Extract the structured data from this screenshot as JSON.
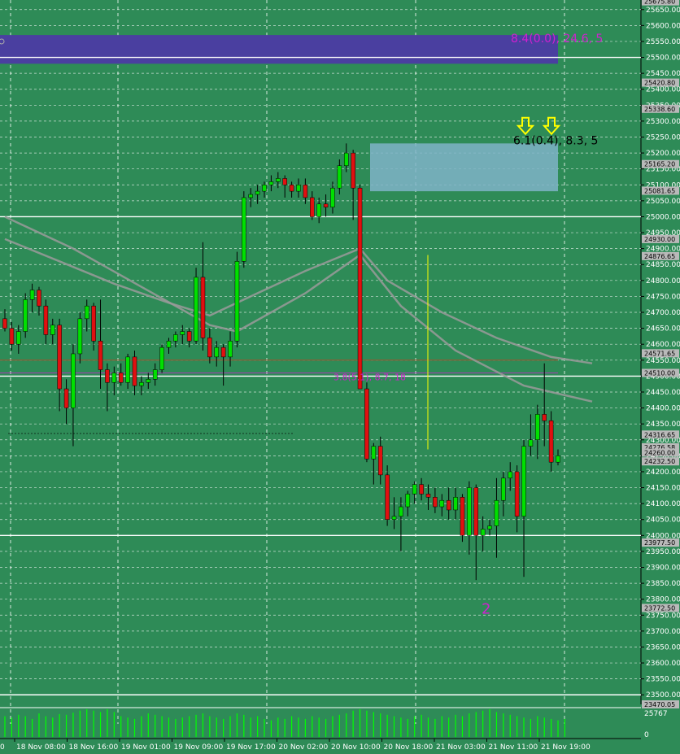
{
  "colors": {
    "background": "#2e8b57",
    "grid": "#ffffff",
    "bull": "#00e000",
    "bear": "#e01010",
    "wick": "#000000",
    "ma": "#9a9a9a",
    "zone_supply": "#4a3fa0",
    "zone_demand": "#7fb3c8",
    "volume": "#00ff00",
    "magenta": "#d020d0",
    "yellow": "#ffff00"
  },
  "chart_data": {
    "type": "candlestick",
    "title": "",
    "ylim": [
      23470,
      25680
    ],
    "price_ticks": [
      25650,
      25600,
      25550,
      25500,
      25450,
      25400,
      25350,
      25300,
      25250,
      25200,
      25150,
      25100,
      25050,
      25000,
      24950,
      24900,
      24850,
      24800,
      24750,
      24700,
      24650,
      24600,
      24550,
      24500,
      24450,
      24400,
      24350,
      24300,
      24250,
      24200,
      24150,
      24100,
      24050,
      24000,
      23950,
      23900,
      23850,
      23800,
      23750,
      23700,
      23650,
      23600,
      23550,
      23500
    ],
    "price_tick_labels": [
      "25650.00",
      "25600.00",
      "25550.00",
      "25500.00",
      "25450.00",
      "25400.00",
      "25350.00",
      "25300.00",
      "25250.00",
      "25200.00",
      "25150.00",
      "25100.00",
      "25050.00",
      "25000.00",
      "24950.00",
      "24900.00",
      "24850.00",
      "24800.00",
      "24750.00",
      "24700.00",
      "24650.00",
      "24600.00",
      "24550.00",
      "24500.00",
      "24450.00",
      "24400.00",
      "24350.00",
      "24300.00",
      "24250.00",
      "24200.00",
      "24150.00",
      "24100.00",
      "24050.00",
      "24000.00",
      "23950.00",
      "23900.00",
      "23850.00",
      "23800.00",
      "23750.00",
      "23700.00",
      "23650.00",
      "23600.00",
      "23550.00",
      "23500.00"
    ],
    "extra_price_labels": [
      {
        "price": 25675.8,
        "text": "25675.80"
      },
      {
        "price": 25420.8,
        "text": "25420.80"
      },
      {
        "price": 25338.6,
        "text": "25338.60"
      },
      {
        "price": 25165.2,
        "text": "25165.20"
      },
      {
        "price": 25081.6,
        "text": "25081.65"
      },
      {
        "price": 24930.0,
        "text": "24930.00"
      },
      {
        "price": 24876.6,
        "text": "24876.65"
      },
      {
        "price": 24571.6,
        "text": "24571.65"
      },
      {
        "price": 24510.0,
        "text": "24510.00"
      },
      {
        "price": 24316.6,
        "text": "24316.65"
      },
      {
        "price": 24276.6,
        "text": "24276.58"
      },
      {
        "price": 24260.0,
        "text": "24260.00"
      },
      {
        "price": 24232.5,
        "text": "24232.50"
      },
      {
        "price": 23977.5,
        "text": "23977.50"
      },
      {
        "price": 23772.5,
        "text": "23772.50"
      },
      {
        "price": 23470.0,
        "text": "23470.05"
      }
    ],
    "highlight_prices": [
      24276.58
    ],
    "time_labels": [
      "18 Nov 08:00",
      "18 Nov 16:00",
      "19 Nov 01:00",
      "19 Nov 09:00",
      "19 Nov 17:00",
      "20 Nov 02:00",
      "20 Nov 10:00",
      "20 Nov 18:00",
      "21 Nov 03:00",
      "21 Nov 11:00",
      "21 Nov 19:00"
    ],
    "first_time_label": "0",
    "volume_labels": [
      "25767",
      "0"
    ],
    "annotations": [
      {
        "text": "8.4(0.0), 24.6, 5",
        "price": 25560,
        "color": "magenta"
      },
      {
        "text": "6.1(0.4), 8.3, 5",
        "price": 25240,
        "color": "black"
      },
      {
        "text": "3.8(5.1), 8.7, 18",
        "price": 24497,
        "color": "magenta"
      },
      {
        "text": "2",
        "price": 23775,
        "color": "magenta"
      }
    ],
    "candles": [
      [
        24680,
        24710,
        24640,
        24650
      ],
      [
        24650,
        24670,
        24580,
        24600
      ],
      [
        24600,
        24660,
        24570,
        24640
      ],
      [
        24640,
        24760,
        24620,
        24740
      ],
      [
        24740,
        24790,
        24700,
        24770
      ],
      [
        24770,
        24780,
        24690,
        24720
      ],
      [
        24720,
        24740,
        24600,
        24630
      ],
      [
        24630,
        24680,
        24600,
        24660
      ],
      [
        24660,
        24680,
        24390,
        24460
      ],
      [
        24460,
        24490,
        24350,
        24400
      ],
      [
        24400,
        24600,
        24280,
        24570
      ],
      [
        24570,
        24700,
        24540,
        24680
      ],
      [
        24680,
        24740,
        24640,
        24720
      ],
      [
        24720,
        24730,
        24580,
        24610
      ],
      [
        24610,
        24740,
        24460,
        24520
      ],
      [
        24520,
        24540,
        24390,
        24480
      ],
      [
        24480,
        24530,
        24440,
        24510
      ],
      [
        24510,
        24540,
        24470,
        24480
      ],
      [
        24480,
        24570,
        24460,
        24560
      ],
      [
        24560,
        24580,
        24440,
        24470
      ],
      [
        24470,
        24500,
        24440,
        24480
      ],
      [
        24480,
        24510,
        24460,
        24490
      ],
      [
        24490,
        24540,
        24470,
        24520
      ],
      [
        24520,
        24600,
        24510,
        24590
      ],
      [
        24590,
        24620,
        24570,
        24610
      ],
      [
        24610,
        24640,
        24590,
        24630
      ],
      [
        24630,
        24660,
        24600,
        24640
      ],
      [
        24640,
        24650,
        24590,
        24610
      ],
      [
        24610,
        24840,
        24600,
        24810
      ],
      [
        24810,
        24920,
        24580,
        24620
      ],
      [
        24620,
        24650,
        24540,
        24560
      ],
      [
        24560,
        24610,
        24530,
        24590
      ],
      [
        24590,
        24600,
        24470,
        24560
      ],
      [
        24560,
        24640,
        24530,
        24610
      ],
      [
        24610,
        24890,
        24590,
        24860
      ],
      [
        24860,
        25080,
        24840,
        25060
      ],
      [
        25060,
        25090,
        25030,
        25070
      ],
      [
        25070,
        25100,
        25040,
        25080
      ],
      [
        25080,
        25110,
        25060,
        25100
      ],
      [
        25100,
        25130,
        25080,
        25110
      ],
      [
        25110,
        25140,
        25090,
        25120
      ],
      [
        25120,
        25130,
        25060,
        25100
      ],
      [
        25100,
        25110,
        25060,
        25080
      ],
      [
        25080,
        25120,
        25060,
        25100
      ],
      [
        25100,
        25120,
        25040,
        25060
      ],
      [
        25060,
        25080,
        24990,
        25000
      ],
      [
        25000,
        25060,
        24980,
        25040
      ],
      [
        25040,
        25070,
        25000,
        25030
      ],
      [
        25030,
        25110,
        25010,
        25090
      ],
      [
        25090,
        25180,
        25070,
        25160
      ],
      [
        25160,
        25230,
        25140,
        25200
      ],
      [
        25200,
        25210,
        24990,
        25090
      ],
      [
        25090,
        25100,
        24460,
        24460
      ],
      [
        24460,
        24480,
        24230,
        24240
      ],
      [
        24240,
        24290,
        24160,
        24280
      ],
      [
        24280,
        24310,
        24160,
        24190
      ],
      [
        24190,
        24220,
        24030,
        24050
      ],
      [
        24050,
        24120,
        24020,
        24060
      ],
      [
        24060,
        24120,
        23950,
        24090
      ],
      [
        24090,
        24140,
        24060,
        24130
      ],
      [
        24130,
        24170,
        24100,
        24160
      ],
      [
        24160,
        24180,
        24110,
        24130
      ],
      [
        24130,
        24160,
        24080,
        24120
      ],
      [
        24120,
        24150,
        24070,
        24090
      ],
      [
        24090,
        24130,
        24060,
        24110
      ],
      [
        24110,
        24150,
        24050,
        24080
      ],
      [
        24080,
        24150,
        24050,
        24120
      ],
      [
        24120,
        24130,
        23980,
        24000
      ],
      [
        24000,
        24170,
        23940,
        24150
      ],
      [
        24150,
        24160,
        23860,
        24000
      ],
      [
        24000,
        24060,
        23950,
        24020
      ],
      [
        24020,
        24050,
        24000,
        24030
      ],
      [
        24030,
        24180,
        23930,
        24110
      ],
      [
        24110,
        24200,
        24060,
        24180
      ],
      [
        24180,
        24230,
        24140,
        24200
      ],
      [
        24200,
        24220,
        24010,
        24060
      ],
      [
        24060,
        24300,
        23870,
        24280
      ],
      [
        24280,
        24380,
        24250,
        24300
      ],
      [
        24300,
        24410,
        24240,
        24380
      ],
      [
        24380,
        24540,
        24280,
        24360
      ],
      [
        24360,
        24390,
        24200,
        24230
      ],
      [
        24230,
        24270,
        24220,
        24250
      ]
    ],
    "moving_averages": [
      {
        "name": "",
        "points": [
          [
            0,
            24930
          ],
          [
            8,
            24860
          ],
          [
            16,
            24790
          ],
          [
            24,
            24730
          ],
          [
            30,
            24690
          ],
          [
            36,
            24750
          ],
          [
            44,
            24830
          ],
          [
            52,
            24900
          ],
          [
            56,
            24800
          ],
          [
            64,
            24700
          ],
          [
            72,
            24620
          ],
          [
            80,
            24560
          ],
          [
            86,
            24540
          ]
        ]
      },
      {
        "name": "",
        "points": [
          [
            0,
            25000
          ],
          [
            10,
            24900
          ],
          [
            20,
            24780
          ],
          [
            30,
            24660
          ],
          [
            34,
            24640
          ],
          [
            44,
            24760
          ],
          [
            52,
            24880
          ],
          [
            58,
            24720
          ],
          [
            66,
            24580
          ],
          [
            76,
            24470
          ],
          [
            82,
            24440
          ],
          [
            86,
            24420
          ]
        ]
      }
    ],
    "volume": [
      30,
      28,
      32,
      30,
      26,
      34,
      30,
      28,
      33,
      32,
      35,
      38,
      40,
      38,
      36,
      40,
      36,
      30,
      28,
      26,
      30,
      34,
      32,
      30,
      28,
      26,
      28,
      30,
      32,
      34,
      30,
      28,
      26,
      30,
      34,
      32,
      28,
      30,
      26,
      24,
      28,
      26,
      30,
      28,
      26,
      30,
      28,
      26,
      30,
      32,
      34,
      38,
      40,
      38,
      36,
      34,
      32,
      30,
      28,
      26,
      30,
      32,
      28,
      26,
      30,
      28,
      32,
      30,
      34,
      36,
      38,
      40,
      36,
      34,
      32,
      30,
      28,
      26,
      30,
      28,
      26,
      24,
      26
    ]
  }
}
